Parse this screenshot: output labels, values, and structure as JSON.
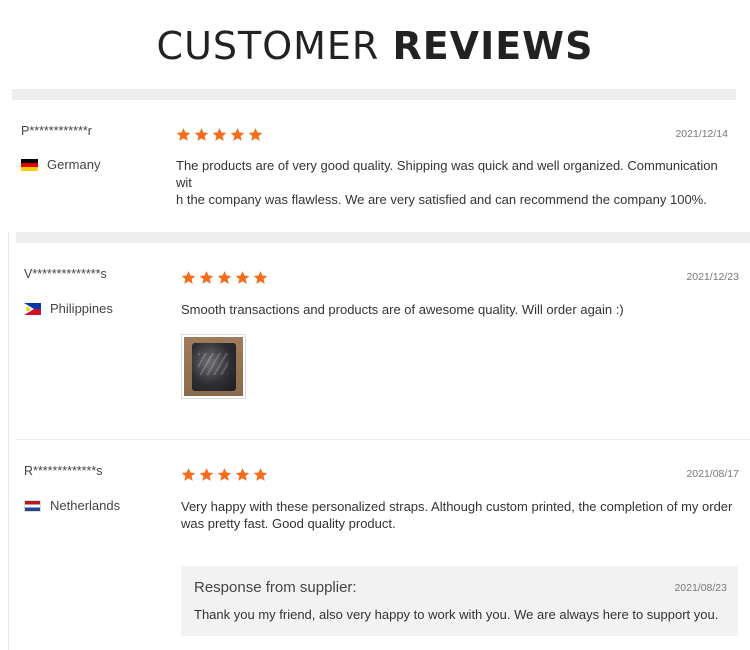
{
  "header": {
    "title_light": "CUSTOMER",
    "title_bold": "REVIEWS"
  },
  "colors": {
    "star": "#f56c1a",
    "divider": "#eeeeee"
  },
  "reviews": [
    {
      "name": "P************r",
      "country": "Germany",
      "flag_icon": "germany-flag-icon",
      "rating": 5,
      "date": "2021/12/14",
      "text_line1": "The products are of very good quality. Shipping was quick and well organized. Communication wit",
      "text_line2": "h the company was flawless. We are very satisfied and can recommend the company 100%."
    },
    {
      "name": "V**************s",
      "country": "Philippines",
      "flag_icon": "philippines-flag-icon",
      "rating": 5,
      "date": "2021/12/23",
      "text_line1": "Smooth transactions and products are of awesome quality. Will order again :)",
      "photo_icon": "review-photo"
    },
    {
      "name": "R*************s",
      "country": "Netherlands",
      "flag_icon": "netherlands-flag-icon",
      "rating": 5,
      "date": "2021/08/17",
      "text_line1": "Very happy with these personalized straps. Although custom printed, the completion of my order",
      "text_line2": "was pretty fast. Good quality product.",
      "supplier_response": {
        "title": "Response from supplier:",
        "date": "2021/08/23",
        "text": "Thank you my friend, also very happy to work with you. We are always here to support you."
      }
    }
  ]
}
